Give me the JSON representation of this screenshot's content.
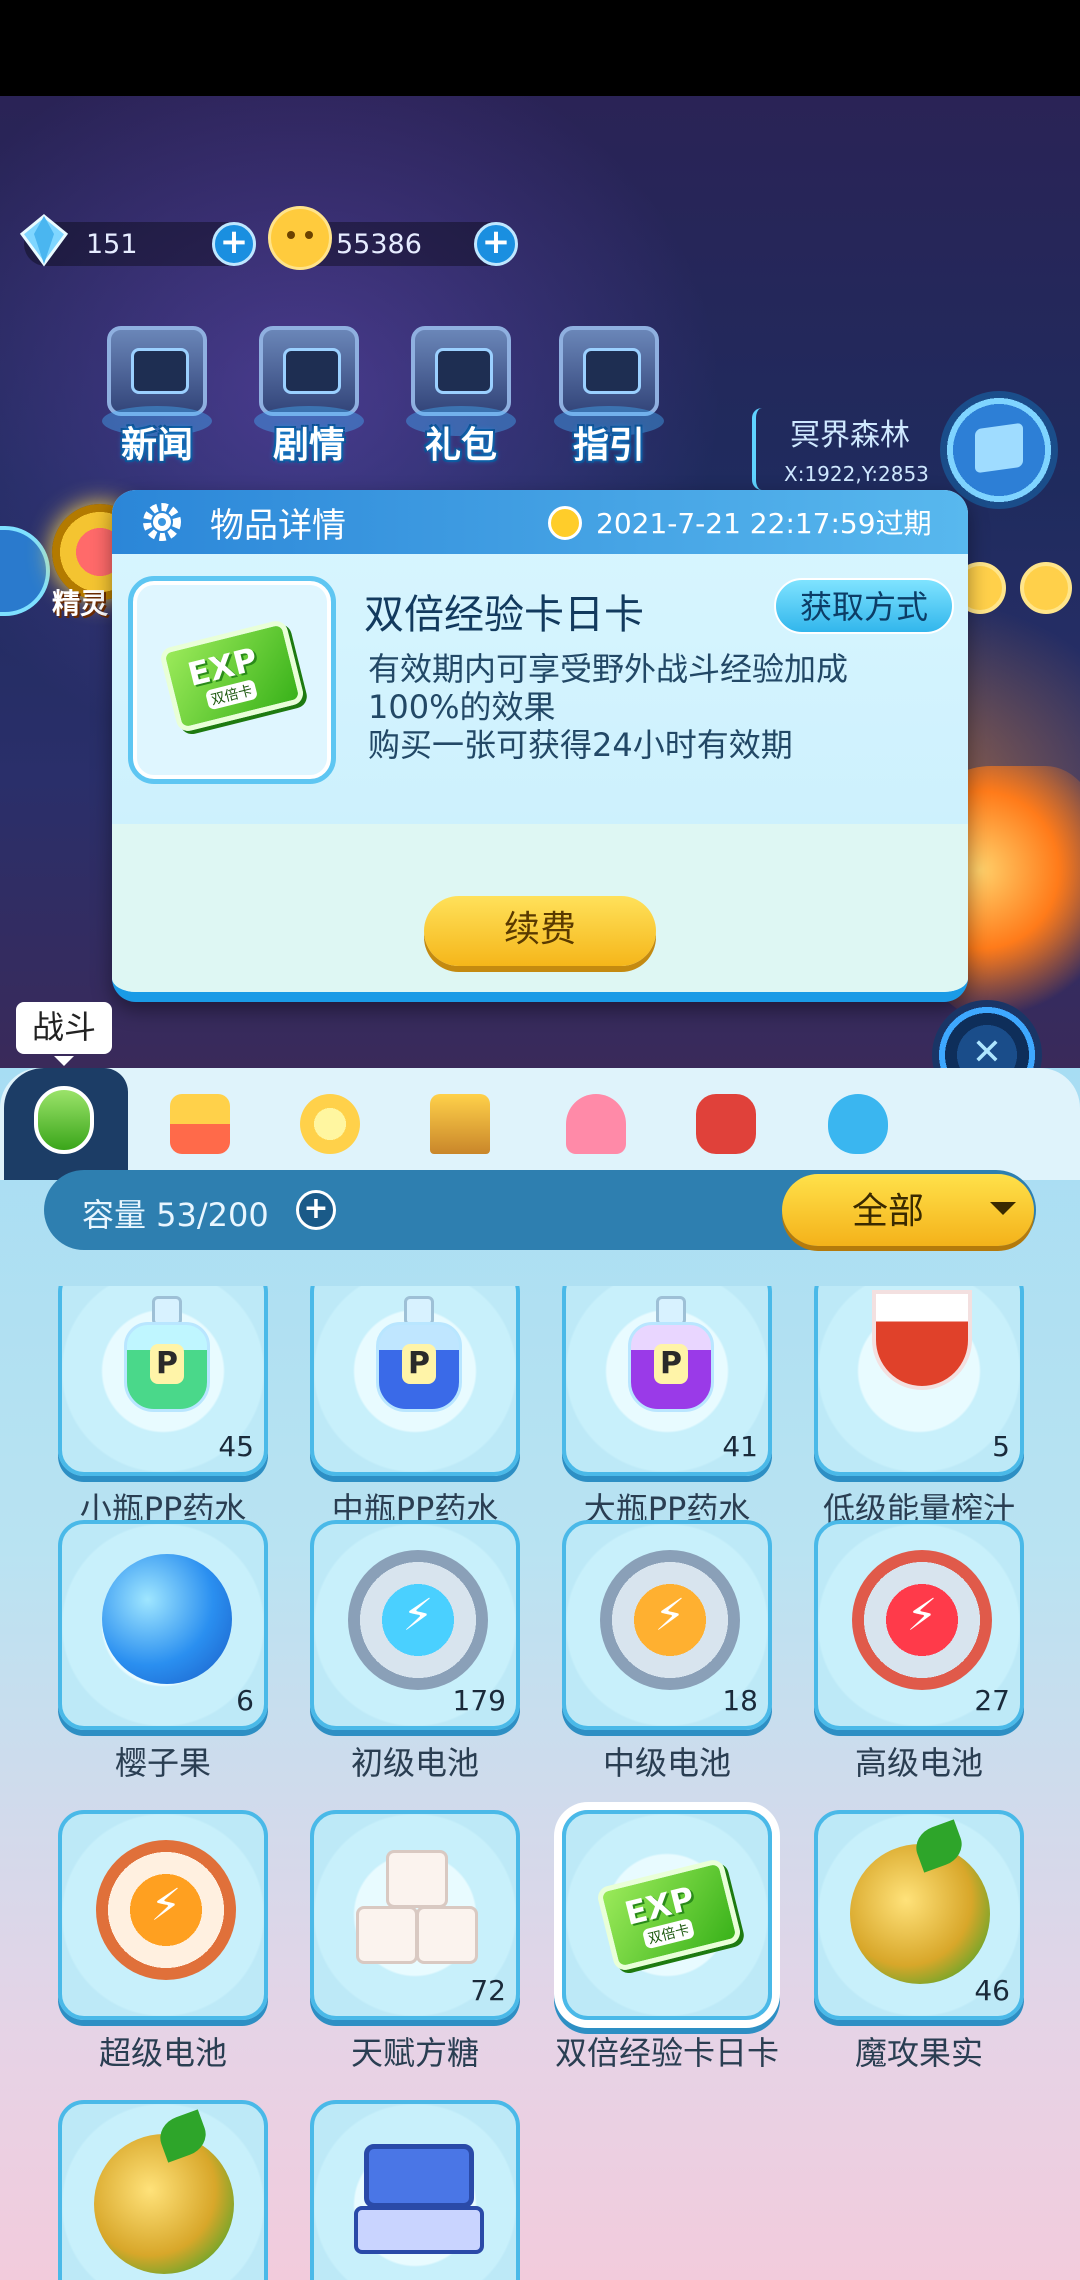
{
  "currency": {
    "gems": "151",
    "coins": "55386"
  },
  "menu": [
    "新闻",
    "剧情",
    "礼包",
    "指引"
  ],
  "location": {
    "name": "冥界森林",
    "coords": "X:1922,Y:2853"
  },
  "activity": {
    "spirit_label": "精灵"
  },
  "dialog": {
    "title": "物品详情",
    "expire": "2021-7-21 22:17:59过期",
    "item_name": "双倍经验卡日卡",
    "get_method": "获取方式",
    "desc_line1": "有效期内可享受野外战斗经验加成",
    "desc_line2": "100%的效果",
    "desc_line3": "购买一张可获得24小时有效期",
    "renew": "续费",
    "card_text": "EXP",
    "card_sub": "双倍卡"
  },
  "tab_tip": "战斗",
  "bag": {
    "capacity": "容量 53/200",
    "filter": "全部"
  },
  "items": [
    {
      "name": "小瓶PP药水",
      "count": "45"
    },
    {
      "name": "中瓶PP药水",
      "count": ""
    },
    {
      "name": "大瓶PP药水",
      "count": "41"
    },
    {
      "name": "低级能量榨汁",
      "count": "5"
    },
    {
      "name": "樱子果",
      "count": "6"
    },
    {
      "name": "初级电池",
      "count": "179"
    },
    {
      "name": "中级电池",
      "count": "18"
    },
    {
      "name": "高级电池",
      "count": "27"
    },
    {
      "name": "超级电池",
      "count": ""
    },
    {
      "name": "天赋方糖",
      "count": "72"
    },
    {
      "name": "双倍经验卡日卡",
      "count": ""
    },
    {
      "name": "魔攻果实",
      "count": "46"
    },
    {
      "name": "",
      "count": ""
    },
    {
      "name": "",
      "count": ""
    }
  ],
  "colors": {
    "accent": "#1a9be6",
    "button_yellow": "#f5b61a",
    "panel_bg": "#a7ddf3"
  }
}
